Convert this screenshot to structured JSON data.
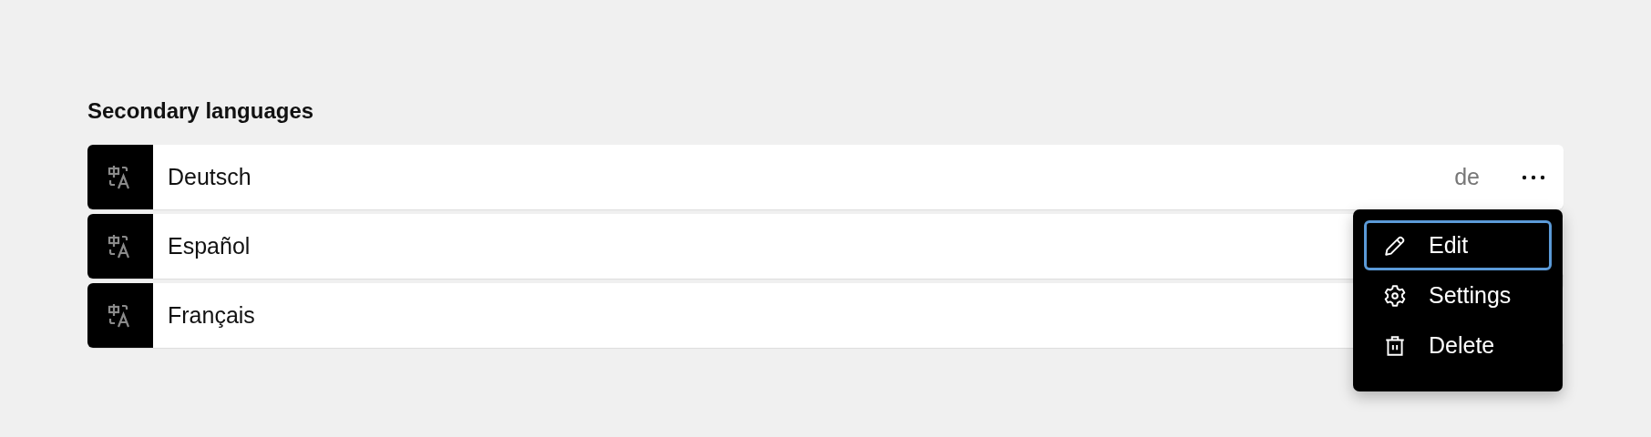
{
  "section_title": "Secondary languages",
  "languages": [
    {
      "name": "Deutsch",
      "code": "de",
      "more_button": true
    },
    {
      "name": "Español"
    },
    {
      "name": "Français"
    }
  ],
  "menu": {
    "items": [
      {
        "kind": "edit",
        "label": "Edit",
        "selected": true
      },
      {
        "kind": "settings",
        "label": "Settings",
        "selected": false
      },
      {
        "kind": "delete",
        "label": "Delete",
        "selected": false
      }
    ]
  }
}
